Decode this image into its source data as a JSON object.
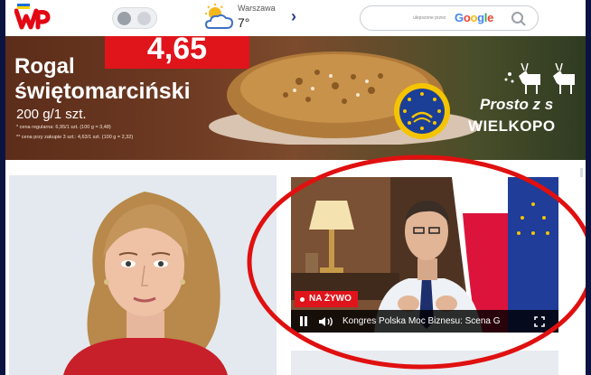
{
  "header": {
    "logo": "wp-logo-icon",
    "theme_toggle": "theme-toggle",
    "weather": {
      "city": "Warszawa",
      "temperature": "7°",
      "icon": "partly-cloudy-icon",
      "next_icon": "chevron-right-icon"
    },
    "search": {
      "powered_by": "ulepszone przez",
      "provider": "Google",
      "icon": "search-icon"
    }
  },
  "ad": {
    "price": "4,65",
    "product_line1": "Rogal",
    "product_line2": "świętomarciński",
    "weight": "200 g/1 szt.",
    "fine_print_1": "* cena regularna: 6,95/1 szt. (100 g = 3,48)",
    "fine_print_2": "** cena przy zakupie 3 szt.: 4,63/1 szt. (100 g = 2,32)",
    "slogan_1": "Prosto z s",
    "slogan_2": "WIELKOPO",
    "seal_icon": "eu-protected-origin-seal-icon",
    "colors": {
      "price_bg": "#e0141b"
    }
  },
  "video": {
    "live_label": "NA ŻYWO",
    "title": "Kongres Polska Moc Biznesu: Scena G",
    "controls": [
      "pause-icon",
      "volume-icon",
      "fullscreen-icon"
    ]
  },
  "colors": {
    "frame": "#0b1440",
    "accent": "#e0141b",
    "highlight_ellipse": "#e01010"
  }
}
